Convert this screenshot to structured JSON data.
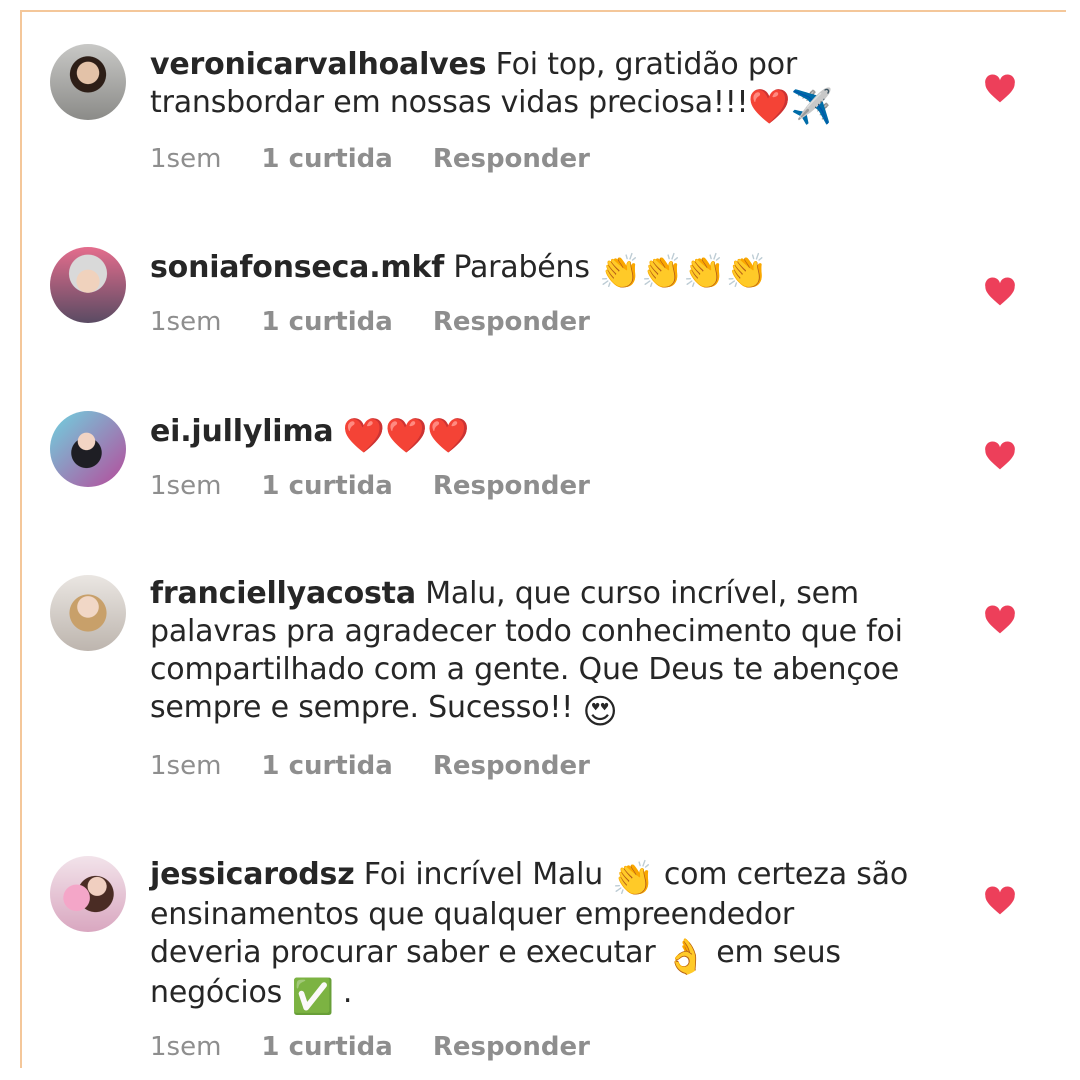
{
  "colors": {
    "heart": "#ed3f5a",
    "meta_text": "#8e8e8e",
    "text": "#262626"
  },
  "comments": [
    {
      "username": "veronicarvalhoalves",
      "text": "Foi top, gratidão por transbordar em nossas vidas preciosa!!!",
      "emojis": "❤️✈️",
      "time": "1sem",
      "likes": "1 curtida",
      "reply": "Responder"
    },
    {
      "username": "soniafonseca.mkf",
      "text": "Parabéns",
      "emojis": "👏👏👏👏",
      "time": "1sem",
      "likes": "1 curtida",
      "reply": "Responder"
    },
    {
      "username": "ei.jullylima",
      "text": "",
      "emojis": "❤️❤️❤️",
      "time": "1sem",
      "likes": "1 curtida",
      "reply": "Responder"
    },
    {
      "username": "franciellyacosta",
      "text": "Malu, que curso incrível, sem palavras pra agradecer todo conhecimento que foi compartilhado com a gente. Que Deus te abençoe sempre e sempre. Sucesso!!",
      "emojis": "😍",
      "time": "1sem",
      "likes": "1 curtida",
      "reply": "Responder"
    },
    {
      "username": "jessicarodsz",
      "text_part1": "Foi incrível Malu",
      "emoji1": "👏",
      "text_part2": "com certeza são ensinamentos que qualquer empreendedor deveria procurar saber e executar",
      "emoji2": "👌",
      "text_part3": "em seus negócios",
      "emoji3": "✅",
      "text_part4": ".",
      "time": "1sem",
      "likes": "1 curtida",
      "reply": "Responder"
    }
  ]
}
